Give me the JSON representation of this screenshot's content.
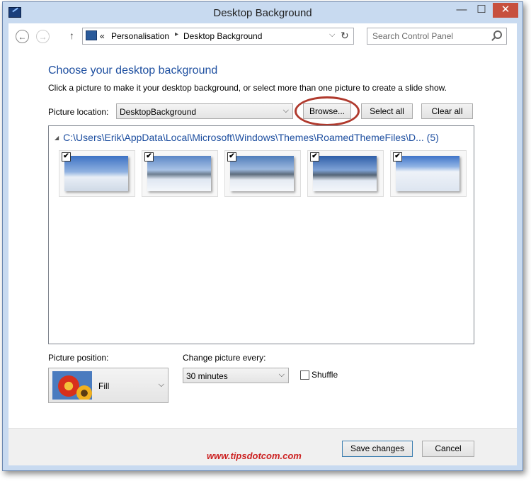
{
  "window": {
    "title": "Desktop Background",
    "minimize_glyph": "—",
    "maximize_glyph": "☐",
    "close_glyph": "✕"
  },
  "nav": {
    "back_glyph": "←",
    "forward_glyph": "→",
    "up_glyph": "↑",
    "address_prefix": "«",
    "breadcrumb": [
      "Personalisation",
      "Desktop Background"
    ],
    "search_placeholder": "Search Control Panel"
  },
  "main": {
    "heading": "Choose your desktop background",
    "description": "Click a picture to make it your desktop background, or select more than one picture to create a slide show.",
    "picture_location_label": "Picture location:",
    "picture_location_value": "DesktopBackground",
    "browse_label": "Browse...",
    "select_all_label": "Select all",
    "clear_all_label": "Clear all",
    "folder": {
      "path": "C:\\Users\\Erik\\AppData\\Local\\Microsoft\\Windows\\Themes\\RoamedThemeFiles\\D...",
      "count": "(5)"
    },
    "thumbnails": [
      {
        "checked": true,
        "check_glyph": "✔",
        "sky": "#3d72c4",
        "ground": "#e8eef6"
      },
      {
        "checked": true,
        "check_glyph": "✔",
        "sky": "#5a86c6",
        "ground": "#dfe7f2"
      },
      {
        "checked": true,
        "check_glyph": "✔",
        "sky": "#4f7dba",
        "ground": "#e5ebf3"
      },
      {
        "checked": true,
        "check_glyph": "✔",
        "sky": "#2e5ea8",
        "ground": "#e2e9f3"
      },
      {
        "checked": true,
        "check_glyph": "✔",
        "sky": "#3f74c8",
        "ground": "#eef2f8"
      }
    ]
  },
  "position": {
    "label": "Picture position:",
    "value": "Fill"
  },
  "change": {
    "label": "Change picture every:",
    "value": "30 minutes"
  },
  "shuffle": {
    "label": "Shuffle",
    "checked": false
  },
  "footer": {
    "watermark": "www.tipsdotcom.com",
    "save_label": "Save changes",
    "cancel_label": "Cancel"
  },
  "colors": {
    "heading": "#1e4fa0",
    "highlight": "#b03a2e",
    "close_button": "#c7503e",
    "frame": "#c8daf0"
  }
}
